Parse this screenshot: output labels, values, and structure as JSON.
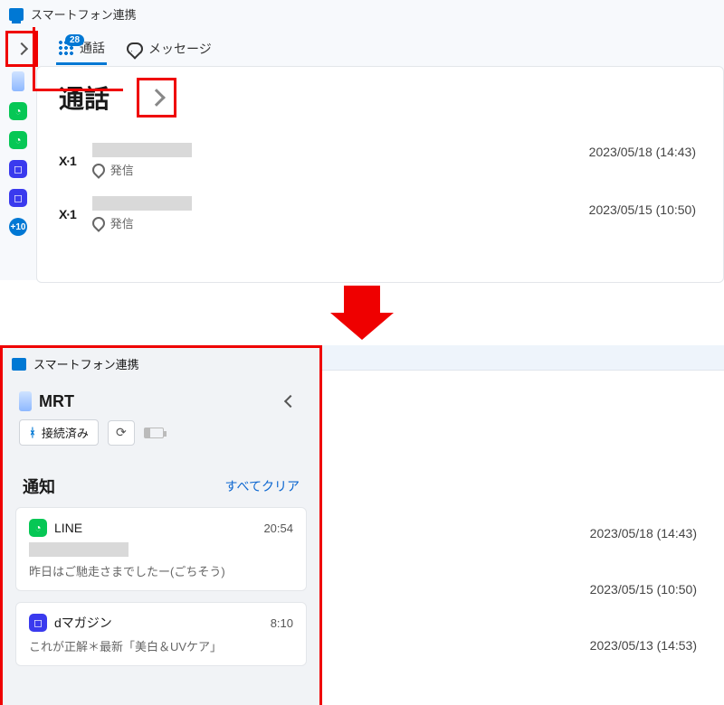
{
  "app": {
    "title": "スマートフォン連携"
  },
  "tabs": {
    "apps_badge": "28",
    "calls_label": "通話",
    "messages_label": "メッセージ"
  },
  "page": {
    "heading": "通話"
  },
  "calls": [
    {
      "icon": "X·1",
      "direction_label": "発信",
      "timestamp": "2023/05/18 (14:43)"
    },
    {
      "icon": "X·1",
      "direction_label": "発信",
      "timestamp": "2023/05/15 (10:50)"
    }
  ],
  "sidebar_badge": "+10",
  "expanded": {
    "device_name": "MRT",
    "bluetooth_status": "接続済み",
    "notifications_heading": "通知",
    "clear_all_label": "すべてクリア",
    "notifications": [
      {
        "app": "LINE",
        "time": "20:54",
        "body": "昨日はご馳走さまでしたー(ごちそう)"
      },
      {
        "app": "dマガジン",
        "time": "8:10",
        "body": "これが正解＊最新「美白＆UVケア」"
      }
    ],
    "right_timestamps": [
      "2023/05/18 (14:43)",
      "2023/05/15 (10:50)",
      "2023/05/13 (14:53)"
    ]
  }
}
